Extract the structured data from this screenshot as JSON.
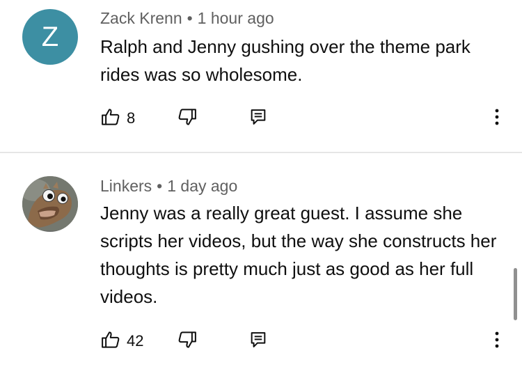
{
  "colors": {
    "avatar_z_bg": "#3d8fa3",
    "meta_text": "#606060",
    "body_text": "#0f0f0f"
  },
  "comments": [
    {
      "author": "Zack Krenn",
      "separator": "•",
      "time": "1 hour ago",
      "avatar_letter": "Z",
      "text": "Ralph and Jenny gushing over the theme park rides was so wholesome.",
      "likes": "8",
      "icons": {
        "like": "thumbs-up-icon",
        "dislike": "thumbs-down-icon",
        "reply": "reply-icon",
        "more": "more-vert-icon"
      }
    },
    {
      "author": "Linkers",
      "separator": "•",
      "time": "1 day ago",
      "avatar_image": "lizard-creature-avatar",
      "text": "Jenny was a really great guest. I assume she scripts her videos, but the way she constructs her thoughts is pretty much just as good as her full videos.",
      "likes": "42",
      "icons": {
        "like": "thumbs-up-icon",
        "dislike": "thumbs-down-icon",
        "reply": "reply-icon",
        "more": "more-vert-icon"
      }
    }
  ]
}
